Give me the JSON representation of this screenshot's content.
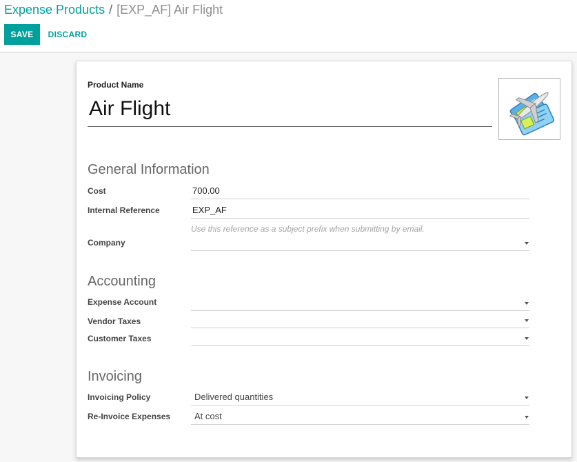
{
  "breadcrumb": {
    "parent": "Expense Products",
    "separator": "/",
    "current": "[EXP_AF] Air Flight"
  },
  "actions": {
    "save": "SAVE",
    "discard": "DISCARD"
  },
  "product": {
    "name_label": "Product Name",
    "name": "Air Flight",
    "image_icon": "air-flight-ticket-icon"
  },
  "general": {
    "title": "General Information",
    "cost_label": "Cost",
    "cost": "700.00",
    "ref_label": "Internal Reference",
    "ref": "EXP_AF",
    "ref_help": "Use this reference as a subject prefix when submitting by email.",
    "company_label": "Company",
    "company": ""
  },
  "accounting": {
    "title": "Accounting",
    "expense_account_label": "Expense Account",
    "expense_account": "",
    "vendor_taxes_label": "Vendor Taxes",
    "vendor_taxes": "",
    "customer_taxes_label": "Customer Taxes",
    "customer_taxes": ""
  },
  "invoicing": {
    "title": "Invoicing",
    "policy_label": "Invoicing Policy",
    "policy": "Delivered quantities",
    "reinvoice_label": "Re-Invoice Expenses",
    "reinvoice": "At cost"
  },
  "colors": {
    "primary": "#00a09d",
    "background": "#f7f7f7"
  }
}
